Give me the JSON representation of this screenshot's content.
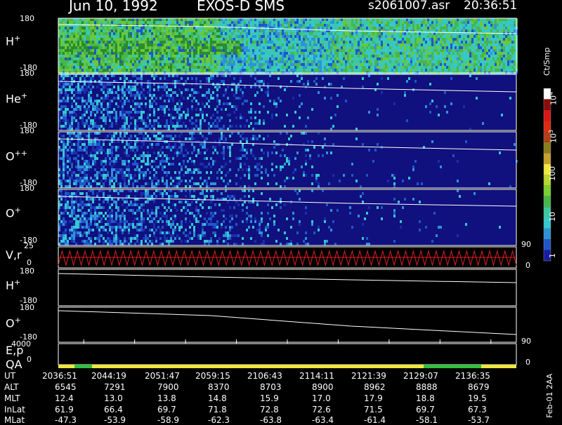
{
  "header": {
    "date": "Jun 10, 1992",
    "instrument": "EXOS-D SMS",
    "filename": "s2061007.asr",
    "time": "20:36:51"
  },
  "panels": [
    {
      "label": "H",
      "sup": "+",
      "ymax": "180",
      "ymin": "-180"
    },
    {
      "label": "He",
      "sup": "+",
      "ymax": "180",
      "ymin": "-180"
    },
    {
      "label": "O",
      "sup": "++",
      "ymax": "180",
      "ymin": "-180"
    },
    {
      "label": "O",
      "sup": "+",
      "ymax": "180",
      "ymin": "-180"
    }
  ],
  "vr_panel": {
    "label": "V,r",
    "ytop": "25",
    "ymid": "0",
    "right_top": "90",
    "right_bottom": "0"
  },
  "line_panels": [
    {
      "label": "H",
      "sup": "+",
      "ymax": "180",
      "ymin": "-180"
    },
    {
      "label": "O",
      "sup": "+",
      "ymax": "180",
      "ymin": "-180"
    }
  ],
  "ep_panel": {
    "label": "E,p",
    "left_value": "4000",
    "right_value": "90"
  },
  "qa_panel": {
    "label": "QA",
    "left_value": "0",
    "right_value": "0"
  },
  "colorbar": {
    "unit": "Ct/Smp",
    "tick_labels": [
      "10^4",
      "10^3",
      "100",
      "10",
      "1"
    ],
    "colors": [
      "#1a1aa6",
      "#1f57c8",
      "#2f92d8",
      "#36c8d0",
      "#3cc8a0",
      "#49b64c",
      "#7ad02f",
      "#b8d62c",
      "#f0e83a",
      "#c8a030",
      "#8a7d1e",
      "#b04018",
      "#e02a14",
      "#d81818",
      "#8a0d0d",
      "#ffffff"
    ]
  },
  "chart_data": {
    "type": "heatmap",
    "title": "Jun 10, 1992   EXOS-D SMS",
    "columns": [
      "UT",
      "ALT",
      "MLT",
      "InLat",
      "MLat"
    ],
    "time_axis": [
      {
        "UT": "2036:51",
        "ALT": "6545",
        "MLT": "12.4",
        "InLat": "61.9",
        "MLat": "-47.3"
      },
      {
        "UT": "2044:19",
        "ALT": "7291",
        "MLT": "13.0",
        "InLat": "66.4",
        "MLat": "-53.9"
      },
      {
        "UT": "2051:47",
        "ALT": "7900",
        "MLT": "13.8",
        "InLat": "69.7",
        "MLat": "-58.9"
      },
      {
        "UT": "2059:15",
        "ALT": "8370",
        "MLT": "14.8",
        "InLat": "71.8",
        "MLat": "-62.3"
      },
      {
        "UT": "2106:43",
        "ALT": "8703",
        "MLT": "15.9",
        "InLat": "72.8",
        "MLat": "-63.8"
      },
      {
        "UT": "2114:11",
        "ALT": "8900",
        "MLT": "17.0",
        "InLat": "72.6",
        "MLat": "-63.4"
      },
      {
        "UT": "2121:39",
        "ALT": "8962",
        "MLT": "17.9",
        "InLat": "71.5",
        "MLat": "-61.4"
      },
      {
        "UT": "2129:07",
        "ALT": "8888",
        "MLT": "18.8",
        "InLat": "69.7",
        "MLat": "-58.1"
      },
      {
        "UT": "2136:35",
        "ALT": "8679",
        "MLT": "19.5",
        "InLat": "67.3",
        "MLat": "-53.7"
      }
    ],
    "pitch_angle_range": [
      -180,
      180
    ],
    "colorbar_unit": "Ct/Smp",
    "version_stamp": "Feb-01 2AA"
  }
}
